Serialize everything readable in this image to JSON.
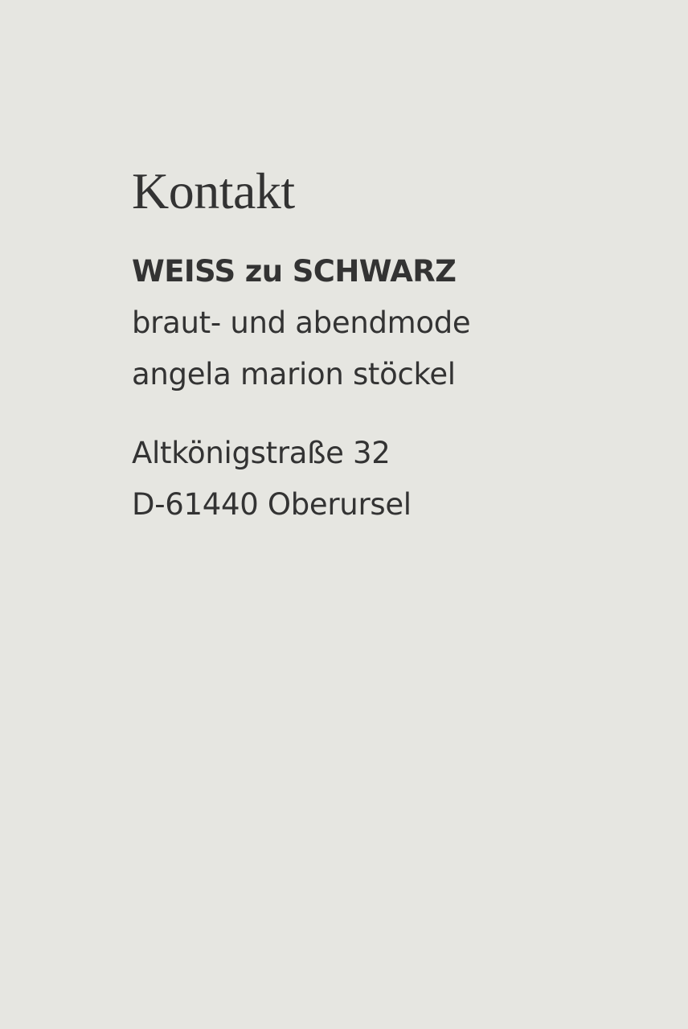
{
  "page": {
    "background_color": "#e6e6e1",
    "text_color": "#333333"
  },
  "contact": {
    "heading": "Kontakt",
    "company": {
      "name": "WEISS zu SCHWARZ",
      "tagline": "braut- und abendmode",
      "owner": "angela marion stöckel"
    },
    "address": {
      "street": "Altkönigstraße 32",
      "city": "D-61440 Oberursel"
    }
  }
}
